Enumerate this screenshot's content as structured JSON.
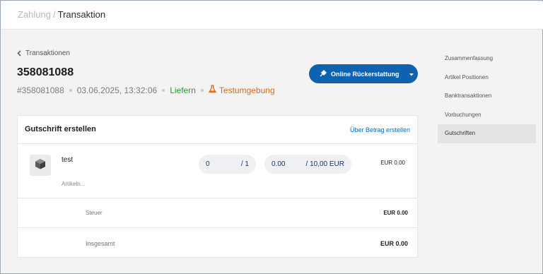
{
  "breadcrumb": {
    "parent": "Zahlung",
    "separator": "/",
    "current": "Transaktion"
  },
  "back_link": "Transaktionen",
  "transaction": {
    "id": "358081088",
    "ref": "#358081088",
    "date": "03.06.2025, 13:32:06",
    "status": "Liefern",
    "environment": "Testumgebung"
  },
  "refund_button": {
    "label": "Online Rückerstattung"
  },
  "card": {
    "title": "Gutschrift erstellen",
    "link": "Über Betrag erstellen",
    "item": {
      "name": "test",
      "subtitle": "Artikeln...",
      "qty_value": "0",
      "qty_max": "/ 1",
      "amount_value": "0.00",
      "amount_max": "/ 10,00 EUR",
      "line_total": "EUR 0.00"
    },
    "tax": {
      "label": "Steuer",
      "value": "EUR 0.00"
    },
    "total": {
      "label": "Insgesamt",
      "value": "EUR 0.00"
    }
  },
  "sidenav": {
    "items": [
      {
        "label": "Zusammenfassung"
      },
      {
        "label": "Artikel Positionen"
      },
      {
        "label": "Banktransaktionen"
      },
      {
        "label": "Vorbuchungen"
      },
      {
        "label": "Gutschriften",
        "active": true
      }
    ]
  },
  "colors": {
    "primary": "#0f62b0",
    "status_green": "#2a9b2a",
    "status_orange": "#e06a16"
  }
}
